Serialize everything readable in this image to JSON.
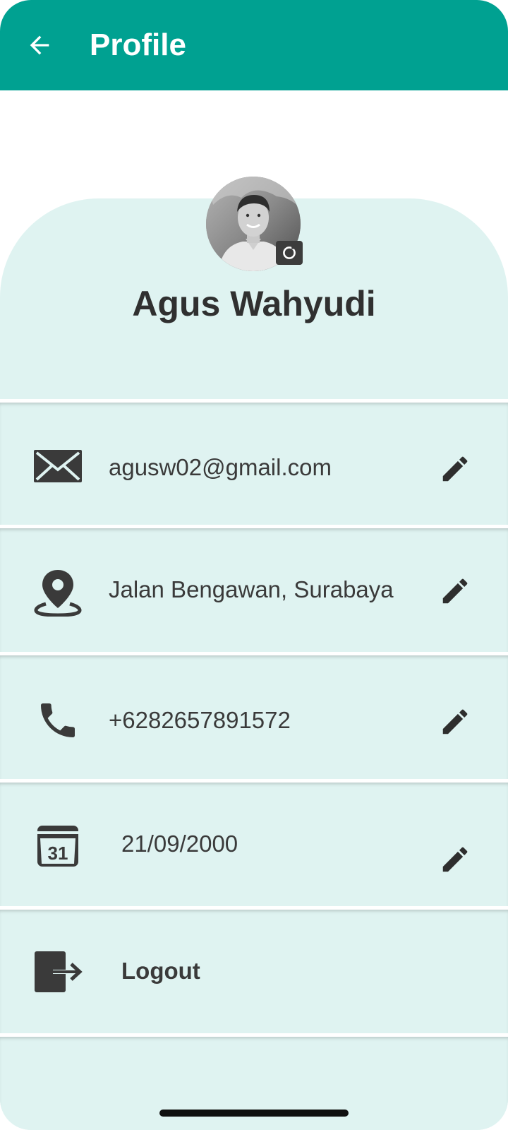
{
  "app_bar": {
    "title": "Profile",
    "back_icon": "arrow-left-icon",
    "background_color": "#00a191"
  },
  "profile": {
    "name": "Agus Wahyudi",
    "avatar_icon": "avatar-photo",
    "camera_icon": "camera-icon"
  },
  "items": [
    {
      "icon": "envelope-icon",
      "value": "agusw02@gmail.com",
      "edit_icon": "pencil-icon"
    },
    {
      "icon": "location-pin-icon",
      "value": "Jalan Bengawan, Surabaya",
      "edit_icon": "pencil-icon"
    },
    {
      "icon": "phone-icon",
      "value": "+6282657891572",
      "edit_icon": "pencil-icon"
    },
    {
      "icon": "calendar-icon",
      "value": "21/09/2000",
      "calendar_day": "31",
      "edit_icon": "pencil-icon"
    }
  ],
  "logout": {
    "icon": "logout-icon",
    "label": "Logout"
  },
  "colors": {
    "accent": "#00a191",
    "panel": "#dff3f1",
    "text": "#3a3a3a"
  }
}
